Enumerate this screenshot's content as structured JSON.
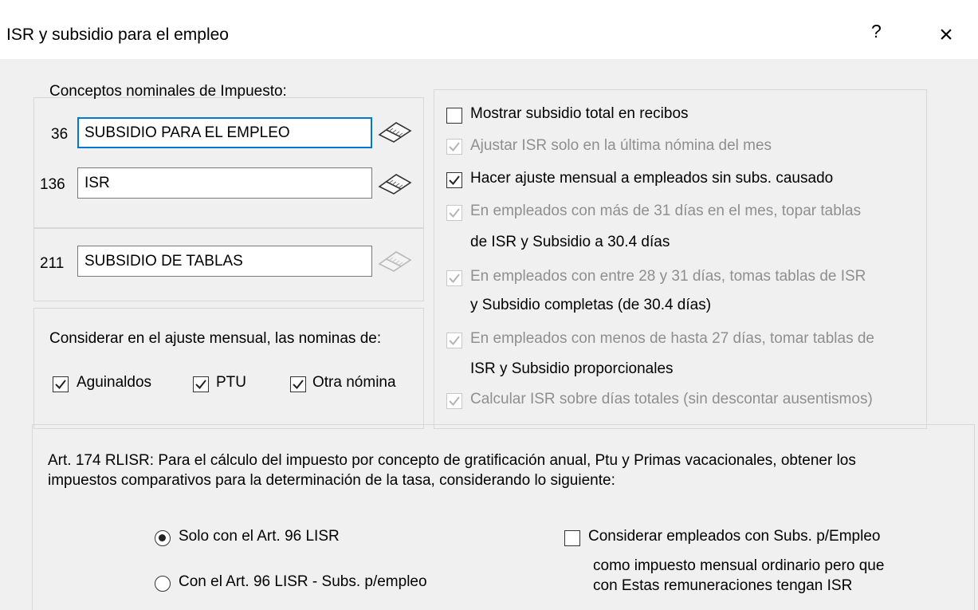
{
  "window": {
    "title": "ISR y subsidio para el empleo",
    "help_label": "?",
    "close_label": "×"
  },
  "conceptos": {
    "heading": "Conceptos nominales de Impuesto:",
    "rows": [
      {
        "code": "36",
        "value": "SUBSIDIO PARA EL EMPLEO"
      },
      {
        "code": "136",
        "value": "ISR"
      }
    ],
    "tablas": {
      "code": "211",
      "value": "SUBSIDIO DE TABLAS"
    }
  },
  "ajuste_mensual": {
    "heading": "Considerar en el ajuste mensual, las nominas de:",
    "options": [
      {
        "label": "Aguinaldos",
        "checked": true
      },
      {
        "label": "PTU",
        "checked": true
      },
      {
        "label": "Otra nómina",
        "checked": true
      }
    ]
  },
  "options": {
    "mostrar_subsidio": {
      "label": "Mostrar subsidio total en recibos",
      "checked": false,
      "enabled": true
    },
    "ajustar_isr": {
      "label": "Ajustar ISR solo en la última nómina del mes",
      "checked": true,
      "enabled": false
    },
    "hacer_ajuste": {
      "label": "Hacer ajuste mensual a empleados sin subs. causado",
      "checked": true,
      "enabled": true
    },
    "topar_tablas": {
      "line1": "En empleados con más de 31 días en el mes, topar tablas",
      "line2": "de ISR y Subsidio a 30.4 días",
      "checked": true,
      "enabled": false
    },
    "tablas_completas": {
      "line1": "En empleados con entre 28 y 31 días, tomas tablas de ISR",
      "line2": "y Subsidio completas (de 30.4 días)",
      "checked": true,
      "enabled": false
    },
    "tablas_proporcionales": {
      "line1": "En empleados con menos de hasta 27 días, tomar tablas de",
      "line2": "ISR y Subsidio proporcionales",
      "checked": true,
      "enabled": false
    },
    "calcular_isr": {
      "label": "Calcular ISR sobre días totales (sin descontar ausentismos)",
      "checked": true,
      "enabled": false
    }
  },
  "art174": {
    "text_line1": "Art. 174 RLISR: Para el cálculo del impuesto por concepto de gratificación anual, Ptu y Primas vacacionales, obtener los",
    "text_line2": "impuestos comparativos para la determinación de la tasa, considerando lo siguiente:",
    "radio_options": [
      {
        "label": "Solo con el Art. 96 LISR",
        "selected": true
      },
      {
        "label": "Con el Art. 96 LISR - Subs. p/empleo",
        "selected": false
      }
    ],
    "considerar": {
      "label": "Considerar empleados con Subs. p/Empleo",
      "checked": false,
      "sub_line1": "como impuesto mensual ordinario pero que",
      "sub_line2": "con Estas remuneraciones tengan ISR"
    }
  }
}
